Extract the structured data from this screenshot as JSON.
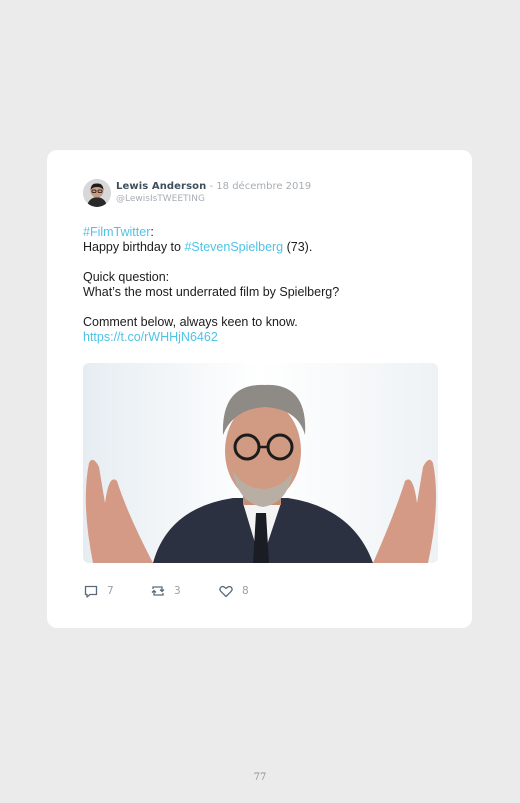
{
  "tweet": {
    "author": "Lewis Anderson",
    "separator": " - ",
    "date": "18 décembre 2019",
    "handle": "@LewisIsTWEETING",
    "hashtag1": "#FilmTwitter",
    "colon": ":",
    "line2_pre": "Happy birthday to ",
    "hashtag2": "#StevenSpielberg",
    "line2_post": " (73).",
    "question_label": "Quick question:",
    "question": "What’s the most underrated film by Spielberg?",
    "comment_line": "Comment below, always keen to know.",
    "link": "https://t.co/rWHHjN6462",
    "replies": "7",
    "retweets": "3",
    "likes": "8",
    "colors": {
      "link": "#4fc3e6",
      "author": "#3f4f5c",
      "muted": "#a8adb3"
    },
    "icons": [
      "reply-icon",
      "retweet-icon",
      "like-icon"
    ]
  },
  "page": {
    "number": "77"
  }
}
